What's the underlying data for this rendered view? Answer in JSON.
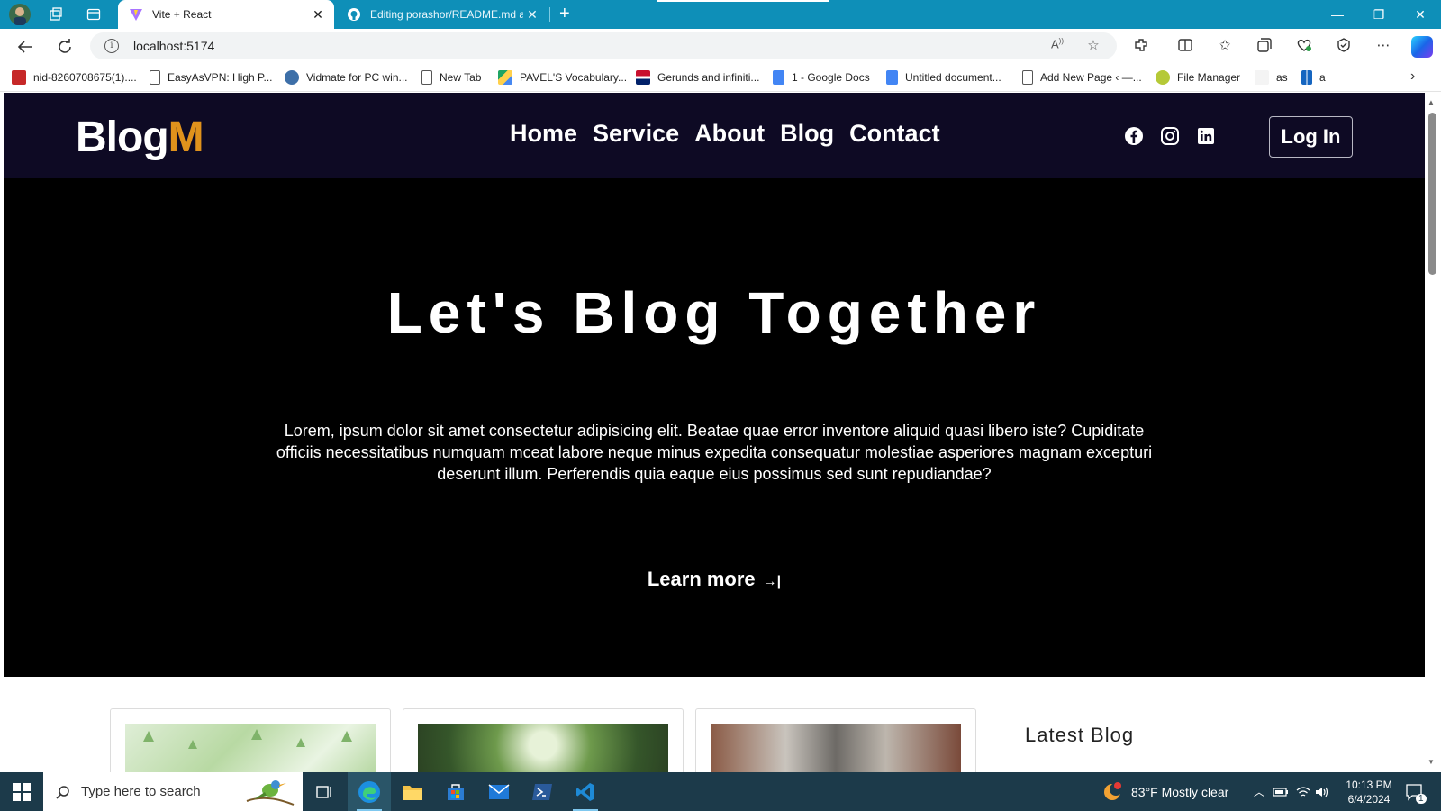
{
  "browser": {
    "tabs": [
      {
        "title": "Vite + React",
        "active": true
      },
      {
        "title": "Editing porashor/README.md at",
        "active": false
      }
    ],
    "address": "localhost:5174",
    "bookmarks": [
      "nid-8260708675(1)....",
      "EasyAsVPN: High P...",
      "Vidmate for PC win...",
      "New Tab",
      "PAVEL'S Vocabulary...",
      "Gerunds and infiniti...",
      "1 - Google Docs",
      "Untitled document...",
      "Add New Page ‹ —...",
      "File Manager",
      "as",
      "a"
    ]
  },
  "site": {
    "logo_main": "Blog",
    "logo_accent": "M",
    "nav": [
      "Home",
      "Service",
      "About",
      "Blog",
      "Contact"
    ],
    "social_icons": [
      "facebook-icon",
      "instagram-icon",
      "linkedin-icon"
    ],
    "login_label": "Log In",
    "hero": {
      "title": "Let's Blog Together",
      "text": "Lorem, ipsum dolor sit amet consectetur adipisicing elit. Beatae quae error inventore aliquid quasi libero iste? Cupiditate officiis necessitatibus numquam mceat labore neque minus expedita consequatur molestiae asperiores magnam excepturi deserunt illum. Perferendis quia eaque eius possimus sed sunt repudiandae?",
      "cta": "Learn more"
    },
    "latest_heading": "Latest Blog",
    "colors": {
      "header_bg": "#0e0a24",
      "accent": "#e0921c",
      "hero_bg": "#000000"
    }
  },
  "taskbar": {
    "search_placeholder": "Type here to search",
    "weather": "83°F  Mostly clear",
    "time": "10:13 PM",
    "date": "6/4/2024",
    "notification_count": "1"
  }
}
